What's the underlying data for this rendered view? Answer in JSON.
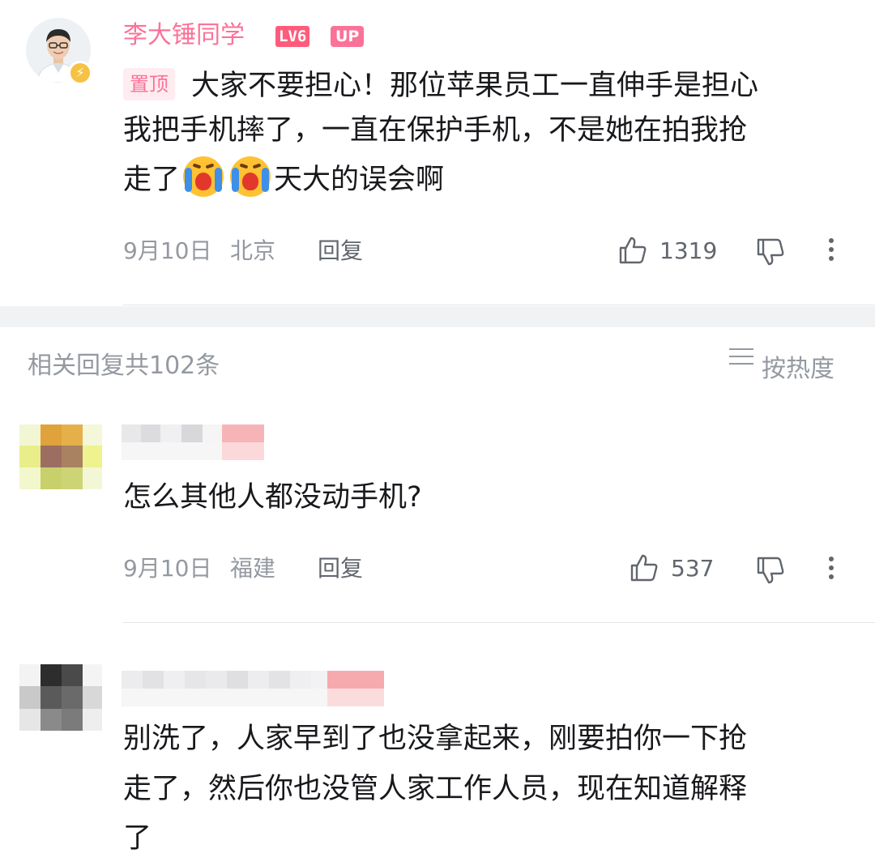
{
  "pinned_comment": {
    "username": "李大锤同学",
    "level_badge": "LV6",
    "up_badge": "UP",
    "pin_tag": "置顶",
    "line1": "大家不要担心！那位苹果员工一直伸手是担心",
    "line2": "我把手机摔了，一直在保护手机，不是她在拍我抢",
    "line3_before_emoji": "走了",
    "line3_after_emoji": "天大的误会啊",
    "emoji_icon": "crying-face-emoji",
    "date": "9月10日",
    "location": "北京",
    "reply_label": "回复",
    "like_count": "1319"
  },
  "replies_header": {
    "title": "相关回复共102条",
    "sort_label": "按热度"
  },
  "replies": [
    {
      "text": "怎么其他人都没动手机?",
      "date": "9月10日",
      "location": "福建",
      "reply_label": "回复",
      "like_count": "537"
    },
    {
      "line1": "别洗了，人家早到了也没拿起来，刚要拍你一下抢",
      "line2": "走了，然后你也没管人家工作人员，现在知道解释",
      "line3": "了"
    }
  ],
  "colors": {
    "brand_pink": "#fb7299",
    "text_primary": "#18191c",
    "text_secondary": "#9499a0",
    "icon_gray": "#61666d"
  }
}
